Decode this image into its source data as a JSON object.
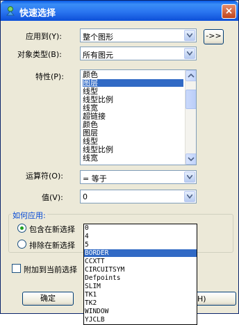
{
  "window": {
    "title": "快速选择"
  },
  "form": {
    "apply_to_label": "应用到(Y):",
    "apply_to_value": "整个图形",
    "select_objects_button": "->>",
    "object_type_label": "对象类型(B):",
    "object_type_value": "所有图元",
    "properties_label": "特性(P):",
    "properties": [
      "颜色",
      "图层",
      "线型",
      "线型比例",
      "线宽",
      "超链接",
      "颜色",
      "图层",
      "线型",
      "线型比例",
      "线宽"
    ],
    "properties_selected_index": 1,
    "operator_label": "运算符(O):",
    "operator_value": "= 等于",
    "value_label": "值(V):",
    "value_value": "0"
  },
  "how_to_apply": {
    "title": "如何应用:",
    "include_label": "包含在新选择",
    "exclude_label": "排除在新选择",
    "include_checked": true
  },
  "append_label": "附加到当前选择",
  "append_checked": false,
  "buttons": {
    "ok": "确定",
    "help_fragment": "H)"
  },
  "value_dropdown": {
    "items": [
      "0",
      "4",
      "5",
      "BORDER",
      "CCXTT",
      "CIRCUITSYM",
      "Defpoints",
      "SLIM",
      "TK1",
      "TK2",
      "WINDOW",
      "YJCLB"
    ],
    "selected_index": 3
  }
}
